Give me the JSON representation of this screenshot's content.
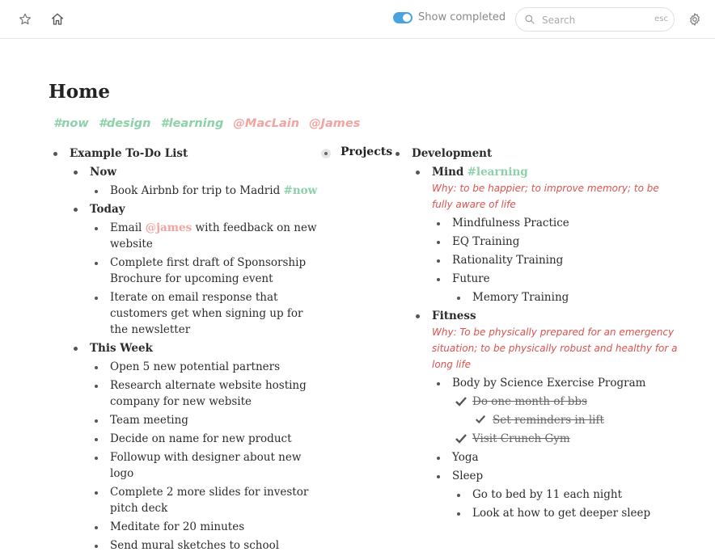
{
  "header": {
    "show_completed_label": "Show completed",
    "show_completed_on": true,
    "search_placeholder": "Search",
    "search_hint": "esc",
    "icons": [
      "star-icon",
      "home-icon",
      "search-icon",
      "settings-icon"
    ]
  },
  "page": {
    "title": "Home",
    "tags": [
      "#now",
      "#design",
      "#learning",
      "@MacLain",
      "@James"
    ]
  },
  "left": {
    "heading": "Example To-Do List",
    "now": {
      "label": "Now",
      "items": [
        {
          "text": "Book Airbnb for trip to Madrid",
          "tag": "#now"
        }
      ]
    },
    "today": {
      "label": "Today",
      "email_pre": "Email",
      "email_mention": "@james",
      "email_post": "with feedback on new website",
      "items": [
        "Complete first draft of Sponsorship Brochure for upcoming event",
        "Iterate on email response that customers get when signing up for the newsletter"
      ]
    },
    "week": {
      "label": "This Week",
      "items": [
        "Open 5 new potential partners",
        "Research alternate website hosting company for new website",
        "Team meeting",
        "Decide on name for new product",
        "Followup with designer about new logo",
        "Complete 2 more slides for investor pitch deck",
        "Meditate for 20 minutes",
        "Send mural sketches to school"
      ]
    }
  },
  "projects": {
    "label": "Projects",
    "development": "Development",
    "mind": {
      "label": "Mind",
      "tag": "#learning",
      "why": "Why: to be happier; to improve memory; to be fully aware of life",
      "items": [
        "Mindfulness Practice",
        "EQ Training",
        "Rationality Training"
      ],
      "future_label": "Future",
      "future_items": [
        "Memory Training"
      ]
    },
    "fitness": {
      "label": "Fitness",
      "why": "Why: To be physically prepared for an emergency situation; to be physically robust and healthy for a long life",
      "program": "Body by Science Exercise Program",
      "done1": "Do one month of bbs",
      "done1_sub": "Set reminders in lift",
      "done2": "Visit Crunch Gym",
      "yoga": "Yoga",
      "sleep": "Sleep",
      "sleep_items": [
        "Go to bed by 11 each night",
        "Look at how to get deeper sleep"
      ]
    }
  }
}
